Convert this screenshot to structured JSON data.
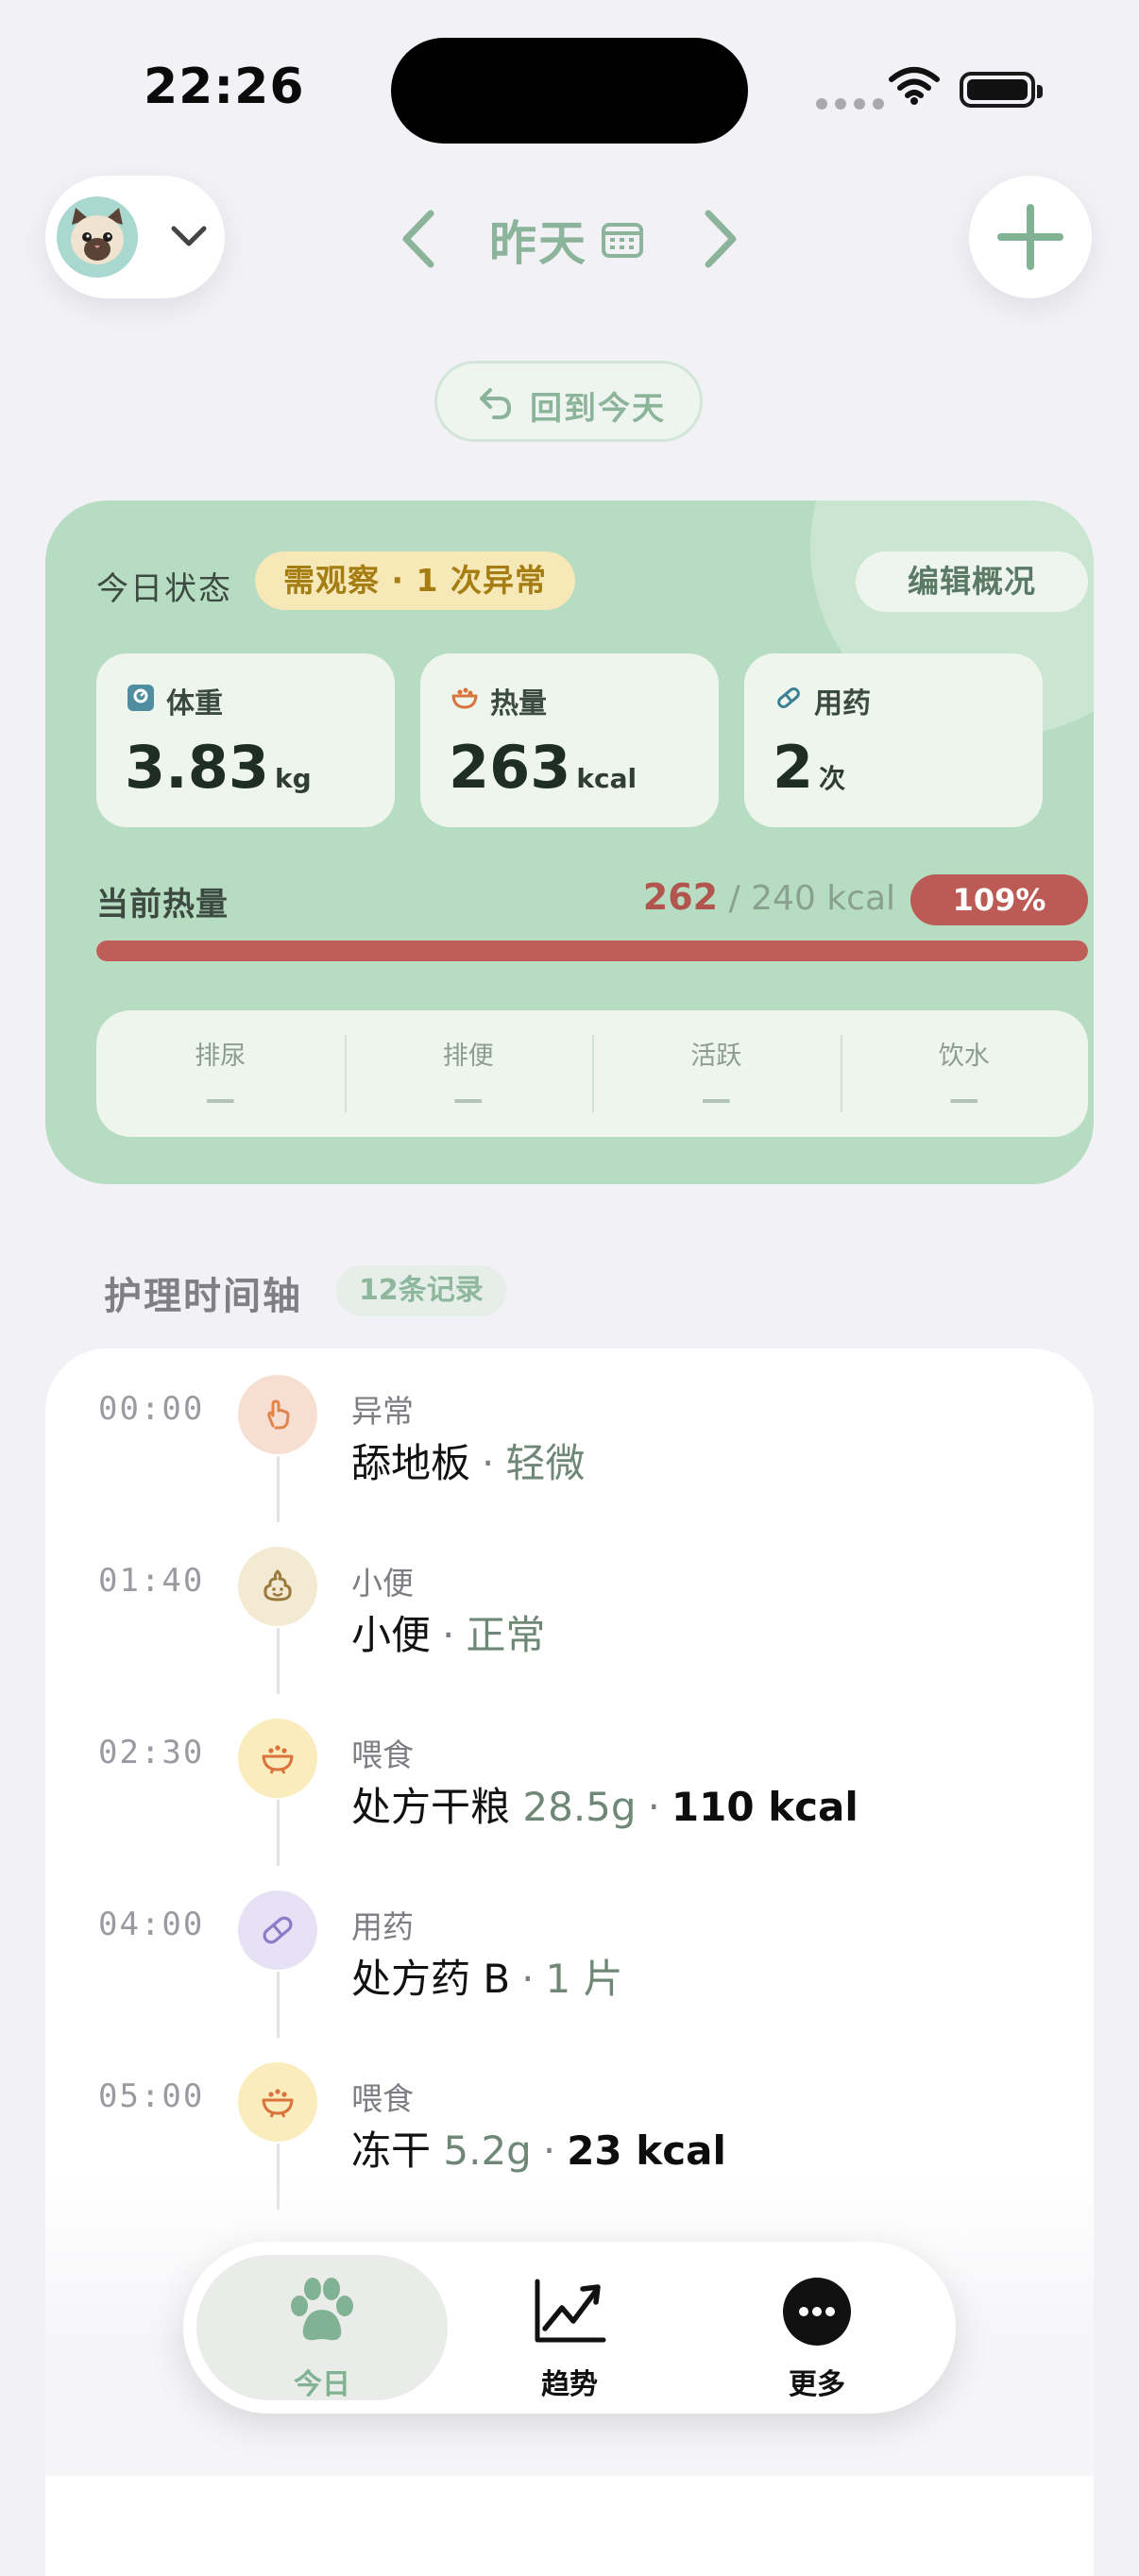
{
  "status_bar": {
    "time": "22:26"
  },
  "header": {
    "date_title": "昨天",
    "back_to_today": "回到今天"
  },
  "status_card": {
    "title": "今日状态",
    "alert_badge": "需观察 · 1 次异常",
    "edit_button": "编辑概况",
    "metrics": [
      {
        "label": "体重",
        "value": "3.83",
        "unit": "kg",
        "icon": "scale-icon"
      },
      {
        "label": "热量",
        "value": "263",
        "unit": "kcal",
        "icon": "food-bowl-icon"
      },
      {
        "label": "用药",
        "value": "2",
        "unit": "次",
        "icon": "pill-icon"
      }
    ],
    "calorie": {
      "label": "当前热量",
      "current": "262",
      "separator": " / ",
      "target": "240 kcal",
      "percent": "109%",
      "progress_fraction": 1.0
    },
    "mini_stats": [
      {
        "label": "排尿",
        "value": "—"
      },
      {
        "label": "排便",
        "value": "—"
      },
      {
        "label": "活跃",
        "value": "—"
      },
      {
        "label": "饮水",
        "value": "—"
      }
    ],
    "colors": {
      "card_bg": "#b6dcc1",
      "alert": "#bc5a55",
      "accent": "#8bb49a"
    }
  },
  "timeline": {
    "heading": "护理时间轴",
    "count": "12条记录",
    "entries": [
      {
        "time": "00:00",
        "category": "异常",
        "name": "舔地板",
        "sub": "轻微",
        "icon": "paw-touch-icon"
      },
      {
        "time": "01:40",
        "category": "小便",
        "name": "小便",
        "sub": "正常",
        "icon": "poop-icon"
      },
      {
        "time": "02:30",
        "category": "喂食",
        "name": "处方干粮",
        "qty": "28.5g",
        "kcal": "110 kcal",
        "icon": "food-bowl-icon"
      },
      {
        "time": "04:00",
        "category": "用药",
        "name": "处方药 B",
        "sub": "1 片",
        "icon": "pill-icon"
      },
      {
        "time": "05:00",
        "category": "喂食",
        "name": "冻干",
        "qty": "5.2g",
        "kcal": "23 kcal",
        "icon": "food-bowl-icon"
      }
    ]
  },
  "tabbar": {
    "tabs": [
      {
        "label": "今日",
        "icon": "paw-icon",
        "active": true
      },
      {
        "label": "趋势",
        "icon": "trend-chart-icon",
        "active": false
      },
      {
        "label": "更多",
        "icon": "more-icon",
        "active": false
      }
    ]
  }
}
